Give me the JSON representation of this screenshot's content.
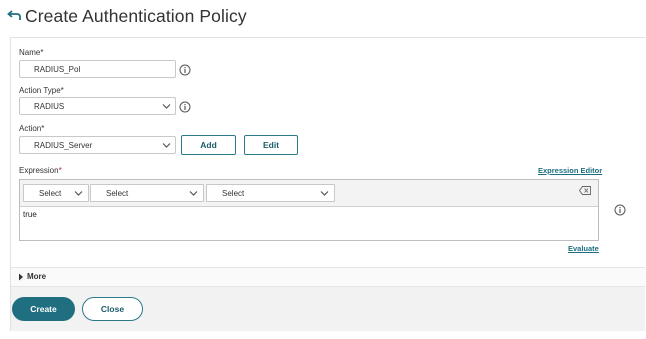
{
  "header": {
    "title": "Create Authentication Policy",
    "back_icon": "back-arrow-icon"
  },
  "form": {
    "name": {
      "label": "Name",
      "required_mark": "*",
      "value": "RADIUS_Pol"
    },
    "action_type": {
      "label": "Action Type",
      "required_mark": "*",
      "value": "RADIUS"
    },
    "action": {
      "label": "Action",
      "required_mark": "*",
      "value": "RADIUS_Server",
      "add_label": "Add",
      "edit_label": "Edit"
    },
    "expression": {
      "label": "Expression",
      "required_mark": "*",
      "editor_link": "Expression Editor",
      "selects": [
        "Select",
        "Select",
        "Select"
      ],
      "value": "true",
      "evaluate_link": "Evaluate"
    }
  },
  "more": {
    "label": "More"
  },
  "footer": {
    "create_label": "Create",
    "close_label": "Close"
  },
  "colors": {
    "accent": "#1f6f80",
    "required": "#c41e3a",
    "link": "#1c6f80"
  }
}
